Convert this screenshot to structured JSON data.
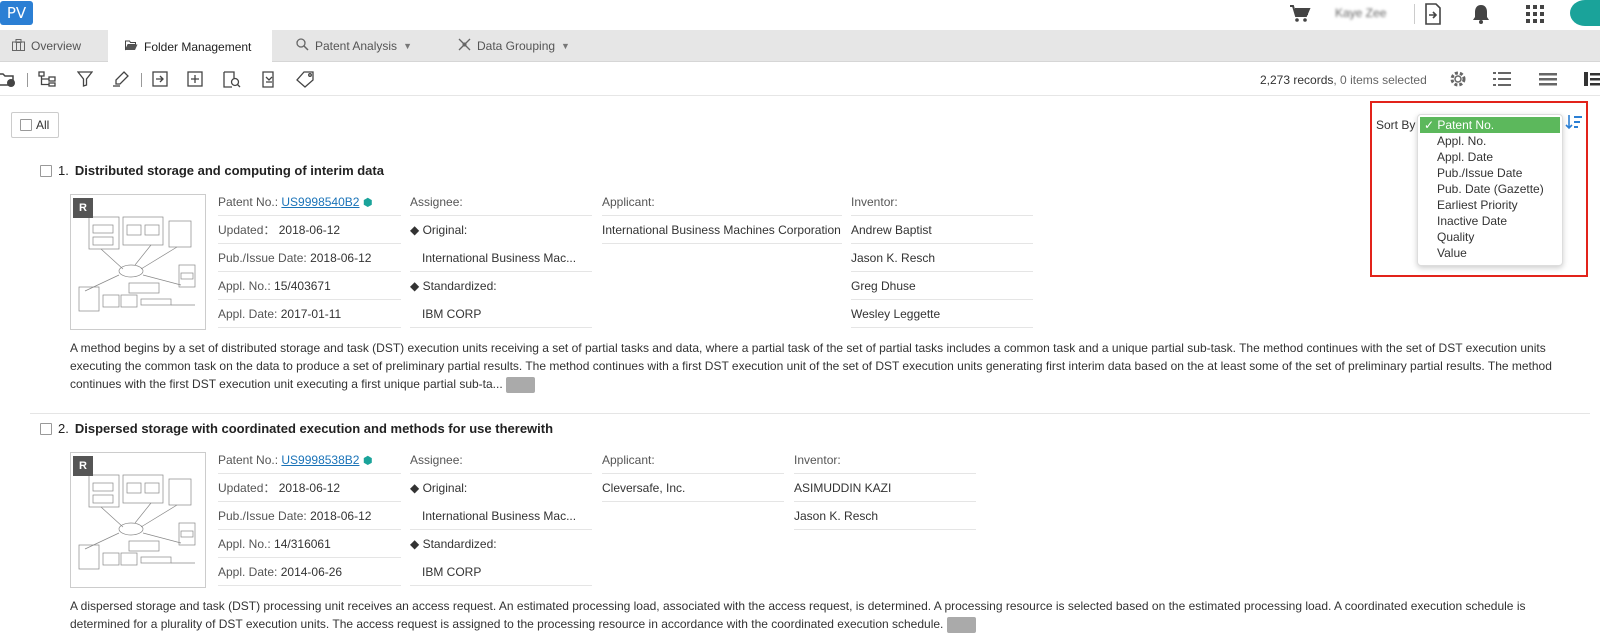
{
  "app": {
    "logo_text": "PV",
    "username": "Kaye Zee"
  },
  "tabs": [
    {
      "label": "Overview",
      "icon": "building-icon"
    },
    {
      "label": "Folder Management",
      "icon": "folder-open-icon"
    },
    {
      "label": "Patent Analysis",
      "icon": "chart-search-icon"
    },
    {
      "label": "Data Grouping",
      "icon": "grouping-icon"
    }
  ],
  "toolbar": {
    "record_count": "2,273 records",
    "items_selected": ", 0 items selected"
  },
  "list": {
    "select_all_label": "All",
    "sort_by_label": "Sort By",
    "sort_options": [
      "Patent No.",
      "Appl. No.",
      "Appl. Date",
      "Pub./Issue Date",
      "Pub. Date (Gazette)",
      "Earliest Priority",
      "Inactive Date",
      "Quality",
      "Value"
    ],
    "sort_selected": "✓ Patent No."
  },
  "labels": {
    "patent_no": "Patent No.:",
    "updated": "Updated：",
    "pub_issue_date": "Pub./Issue Date:",
    "appl_no": "Appl. No.:",
    "appl_date": "Appl. Date:",
    "assignee": "Assignee:",
    "original": "Original:",
    "standardized": "Standardized:",
    "applicant": "Applicant:",
    "inventor": "Inventor:",
    "rating_badge": "R"
  },
  "records": [
    {
      "index": "1.",
      "title": "Distributed storage and computing of interim data",
      "patent_no": "US9998540B2",
      "updated": "2018-06-12",
      "pub_issue_date": "2018-06-12",
      "appl_no": "15/403671",
      "appl_date": "2017-01-11",
      "assignee_original": "International Business Mac...",
      "assignee_standardized": "IBM CORP",
      "applicant": "International Business Machines Corporation",
      "inventors": [
        "Andrew Baptist",
        "Jason K. Resch",
        "Greg Dhuse",
        "Wesley Leggette"
      ],
      "abstract": "A method begins by a set of distributed storage and task (DST) execution units receiving a set of partial tasks and data, where a partial task of the set of partial tasks includes a common task and a unique partial sub-task. The method continues with the set of DST execution units executing the common task on the data to produce a set of preliminary partial results. The method continues with a first DST execution unit of the set of DST execution units generating first interim data based on the at least some of the set of preliminary partial results. The method continues with the first DST execution unit executing a first unique partial sub-ta..."
    },
    {
      "index": "2.",
      "title": "Dispersed storage with coordinated execution and methods for use therewith",
      "patent_no": "US9998538B2",
      "updated": "2018-06-12",
      "pub_issue_date": "2018-06-12",
      "appl_no": "14/316061",
      "appl_date": "2014-06-26",
      "assignee_original": "International Business Mac...",
      "assignee_standardized": "IBM CORP",
      "applicant": "Cleversafe, Inc.",
      "inventors": [
        "ASIMUDDIN KAZI",
        "Jason K. Resch"
      ],
      "abstract": "A dispersed storage and task (DST) processing unit receives an access request. An estimated processing load, associated with the access request, is determined. A processing resource is selected based on the estimated processing load. A coordinated execution schedule is determined for a plurality of DST execution units. The access request is assigned to the processing resource in accordance with the coordinated execution schedule."
    }
  ]
}
